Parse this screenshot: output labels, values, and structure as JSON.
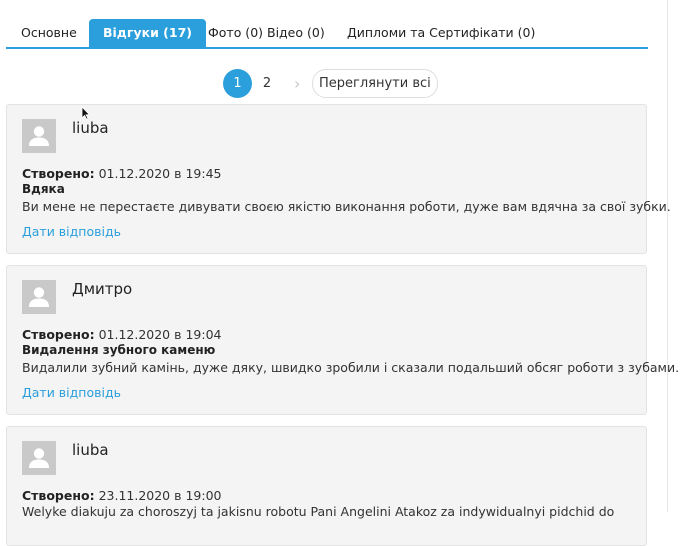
{
  "tabs": [
    {
      "label": "Основне"
    },
    {
      "label": "Відгуки (17)"
    },
    {
      "label": "Фото (0) Відео (0)"
    },
    {
      "label": "Дипломи та Сертифікати (0)"
    }
  ],
  "pagination": {
    "pages": [
      "1",
      "2"
    ],
    "current": "1",
    "next": "›",
    "view_all": "Переглянути всі"
  },
  "reviews": [
    {
      "author": "liuba",
      "created_label": "Створено:",
      "created": "01.12.2020 в 19:45",
      "title": "Вдяка",
      "text": "Ви мене не перестаєте дивувати своєю якістю виконання роботи, дуже вам вдячна за свої зубки.",
      "reply": "Дати відповідь"
    },
    {
      "author": "Дмитро",
      "created_label": "Створено:",
      "created": "01.12.2020 в 19:04",
      "title": "Видалення зубного каменю",
      "text": "Видалили зубний камінь, дуже дяку, швидко зробили і сказали подальший обсяг роботи з зубами.",
      "reply": "Дати відповідь"
    },
    {
      "author": "liuba",
      "created_label": "Створено:",
      "created": "23.11.2020 в 19:00",
      "text": "Welyke diakuju za choroszyj ta jakisnu robotu Pani Angelini Atakoz za indywidualnyi pidchid do"
    }
  ],
  "colors": {
    "accent": "#2a9fdc",
    "card_bg": "#f4f4f4",
    "avatar": "#c9c9c9"
  }
}
